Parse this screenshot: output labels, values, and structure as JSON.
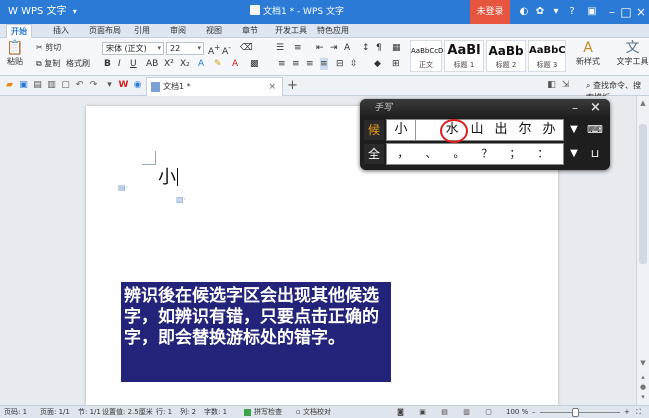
{
  "titlebar": {
    "app_name": "WPS 文字",
    "doc_title": "文档1 * - WPS 文字",
    "login_label": "未登录"
  },
  "menu": {
    "tabs": [
      "开始",
      "插入",
      "页面布局",
      "引用",
      "审阅",
      "视图",
      "章节",
      "开发工具",
      "特色应用"
    ]
  },
  "ribbon": {
    "paste": "粘贴",
    "cut": "剪切",
    "copy": "复制",
    "format_painter": "格式刷",
    "font_name": "宋体 (正文)",
    "font_size": "22",
    "styles": [
      {
        "sample": "AaBbCcDd",
        "label": "正文"
      },
      {
        "sample": "AaBl",
        "label": "标题 1"
      },
      {
        "sample": "AaBb",
        "label": "标题 2"
      },
      {
        "sample": "AaBbC",
        "label": "标题 3"
      }
    ],
    "new_style": "新样式",
    "text_tool": "文字工具"
  },
  "quickbar": {
    "doc_tab": "文档1 *",
    "search": "查找命令、搜索模板"
  },
  "document": {
    "typed_text": "小",
    "textbox": "辨识後在候选字区会出现其他候选字，如辨识有错，只要点击正确的字，即会替换游标处的错字。"
  },
  "ime": {
    "logo": "手写",
    "mode_top": "候",
    "mode_bottom": "全",
    "candidates": [
      "小",
      "水",
      "山",
      "出",
      "尔",
      "办"
    ],
    "selected_index": 1,
    "punctuation": [
      "，",
      "、",
      "。",
      "？",
      "；",
      "："
    ],
    "colors": {
      "selected_ring": "#e02020",
      "mode_top": "#f0a020"
    }
  },
  "status": {
    "page_num": "页码: 1",
    "pages": "页面: 1/1",
    "section": "节: 1/1",
    "setting": "设置值: 2.5厘米",
    "row": "行: 1",
    "col": "列: 2",
    "words": "字数: 1",
    "spell": "拼写检查",
    "proof": "文档校对",
    "zoom": "100 %"
  },
  "colors": {
    "titlebar": "#2b7bd6",
    "login": "#e8553e",
    "textbox_bg": "#23237a"
  }
}
